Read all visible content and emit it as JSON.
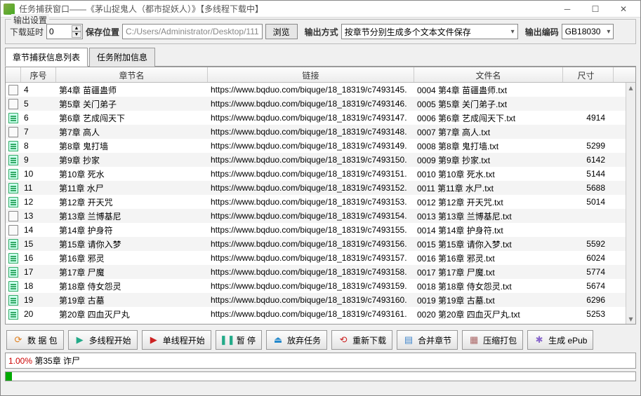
{
  "window": {
    "title": "任务捕获窗口——《茅山捉鬼人（都市捉妖人）》【多线程下载中】"
  },
  "output": {
    "group_title": "输出设置",
    "delay_label": "下载延时",
    "delay_value": "0",
    "save_label": "保存位置",
    "save_path": "C:/Users/Administrator/Desktop/111",
    "browse": "浏览",
    "output_mode_label": "输出方式",
    "output_mode_value": "按章节分别生成多个文本文件保存",
    "encoding_label": "输出编码",
    "encoding_value": "GB18030"
  },
  "tabs": {
    "list": "章节捕获信息列表",
    "extra": "任务附加信息"
  },
  "columns": {
    "seq": "序号",
    "name": "章节名",
    "link": "链接",
    "file": "文件名",
    "size": "尺寸"
  },
  "rows": [
    {
      "icon": "gray",
      "seq": "4",
      "name": "第4章 苗疆蛊师",
      "link": "https://www.bqduo.com/biquge/18_18319/c7493145.",
      "file": "0004 第4章 苗疆蛊师.txt",
      "size": ""
    },
    {
      "icon": "gray",
      "seq": "5",
      "name": "第5章 关门弟子",
      "link": "https://www.bqduo.com/biquge/18_18319/c7493146.",
      "file": "0005 第5章 关门弟子.txt",
      "size": ""
    },
    {
      "icon": "green",
      "seq": "6",
      "name": "第6章 艺成闯天下",
      "link": "https://www.bqduo.com/biquge/18_18319/c7493147.",
      "file": "0006 第6章 艺成闯天下.txt",
      "size": "4914"
    },
    {
      "icon": "gray",
      "seq": "7",
      "name": "第7章 高人",
      "link": "https://www.bqduo.com/biquge/18_18319/c7493148.",
      "file": "0007 第7章 高人.txt",
      "size": ""
    },
    {
      "icon": "green",
      "seq": "8",
      "name": "第8章 鬼打墙",
      "link": "https://www.bqduo.com/biquge/18_18319/c7493149.",
      "file": "0008 第8章 鬼打墙.txt",
      "size": "5299"
    },
    {
      "icon": "green",
      "seq": "9",
      "name": "第9章 抄家",
      "link": "https://www.bqduo.com/biquge/18_18319/c7493150.",
      "file": "0009 第9章 抄家.txt",
      "size": "6142"
    },
    {
      "icon": "green",
      "seq": "10",
      "name": "第10章 死水",
      "link": "https://www.bqduo.com/biquge/18_18319/c7493151.",
      "file": "0010 第10章 死水.txt",
      "size": "5144"
    },
    {
      "icon": "green",
      "seq": "11",
      "name": "第11章 水尸",
      "link": "https://www.bqduo.com/biquge/18_18319/c7493152.",
      "file": "0011 第11章 水尸.txt",
      "size": "5688"
    },
    {
      "icon": "green",
      "seq": "12",
      "name": "第12章 开天咒",
      "link": "https://www.bqduo.com/biquge/18_18319/c7493153.",
      "file": "0012 第12章 开天咒.txt",
      "size": "5014"
    },
    {
      "icon": "gray",
      "seq": "13",
      "name": "第13章 兰博基尼",
      "link": "https://www.bqduo.com/biquge/18_18319/c7493154.",
      "file": "0013 第13章 兰博基尼.txt",
      "size": ""
    },
    {
      "icon": "gray",
      "seq": "14",
      "name": "第14章 护身符",
      "link": "https://www.bqduo.com/biquge/18_18319/c7493155.",
      "file": "0014 第14章 护身符.txt",
      "size": ""
    },
    {
      "icon": "green",
      "seq": "15",
      "name": "第15章 请你入梦",
      "link": "https://www.bqduo.com/biquge/18_18319/c7493156.",
      "file": "0015 第15章 请你入梦.txt",
      "size": "5592"
    },
    {
      "icon": "green",
      "seq": "16",
      "name": "第16章 邪灵",
      "link": "https://www.bqduo.com/biquge/18_18319/c7493157.",
      "file": "0016 第16章 邪灵.txt",
      "size": "6024"
    },
    {
      "icon": "green",
      "seq": "17",
      "name": "第17章 尸魔",
      "link": "https://www.bqduo.com/biquge/18_18319/c7493158.",
      "file": "0017 第17章 尸魔.txt",
      "size": "5774"
    },
    {
      "icon": "green",
      "seq": "18",
      "name": "第18章 侍女怨灵",
      "link": "https://www.bqduo.com/biquge/18_18319/c7493159.",
      "file": "0018 第18章 侍女怨灵.txt",
      "size": "5674"
    },
    {
      "icon": "green",
      "seq": "19",
      "name": "第19章 古墓",
      "link": "https://www.bqduo.com/biquge/18_18319/c7493160.",
      "file": "0019 第19章 古墓.txt",
      "size": "6296"
    },
    {
      "icon": "green",
      "seq": "20",
      "name": "第20章 四血灭尸丸",
      "link": "https://www.bqduo.com/biquge/18_18319/c7493161.",
      "file": "0020 第20章 四血灭尸丸.txt",
      "size": "5253"
    }
  ],
  "toolbar": {
    "data_pack": "数 据 包",
    "multi_start": "多线程开始",
    "single_start": "单线程开始",
    "pause": "暂  停",
    "abandon": "放弃任务",
    "redownload": "重新下载",
    "merge": "合并章节",
    "compress": "压缩打包",
    "epub": "生成 ePub"
  },
  "status": {
    "percent": "1.00%",
    "text": "第35章 诈尸"
  },
  "icons": {
    "data_pack": "⟳",
    "multi_start": "▶",
    "single_start": "▶",
    "pause": "❚❚",
    "abandon": "⏏",
    "redownload": "⟲",
    "merge": "▤",
    "compress": "▦",
    "epub": "✱"
  },
  "colors": {
    "data_pack": "#e08020",
    "multi_start": "#2a8",
    "single_start": "#c22",
    "pause": "#2a8",
    "abandon": "#28c",
    "redownload": "#c22",
    "merge": "#48c",
    "compress": "#a66",
    "epub": "#86c"
  }
}
